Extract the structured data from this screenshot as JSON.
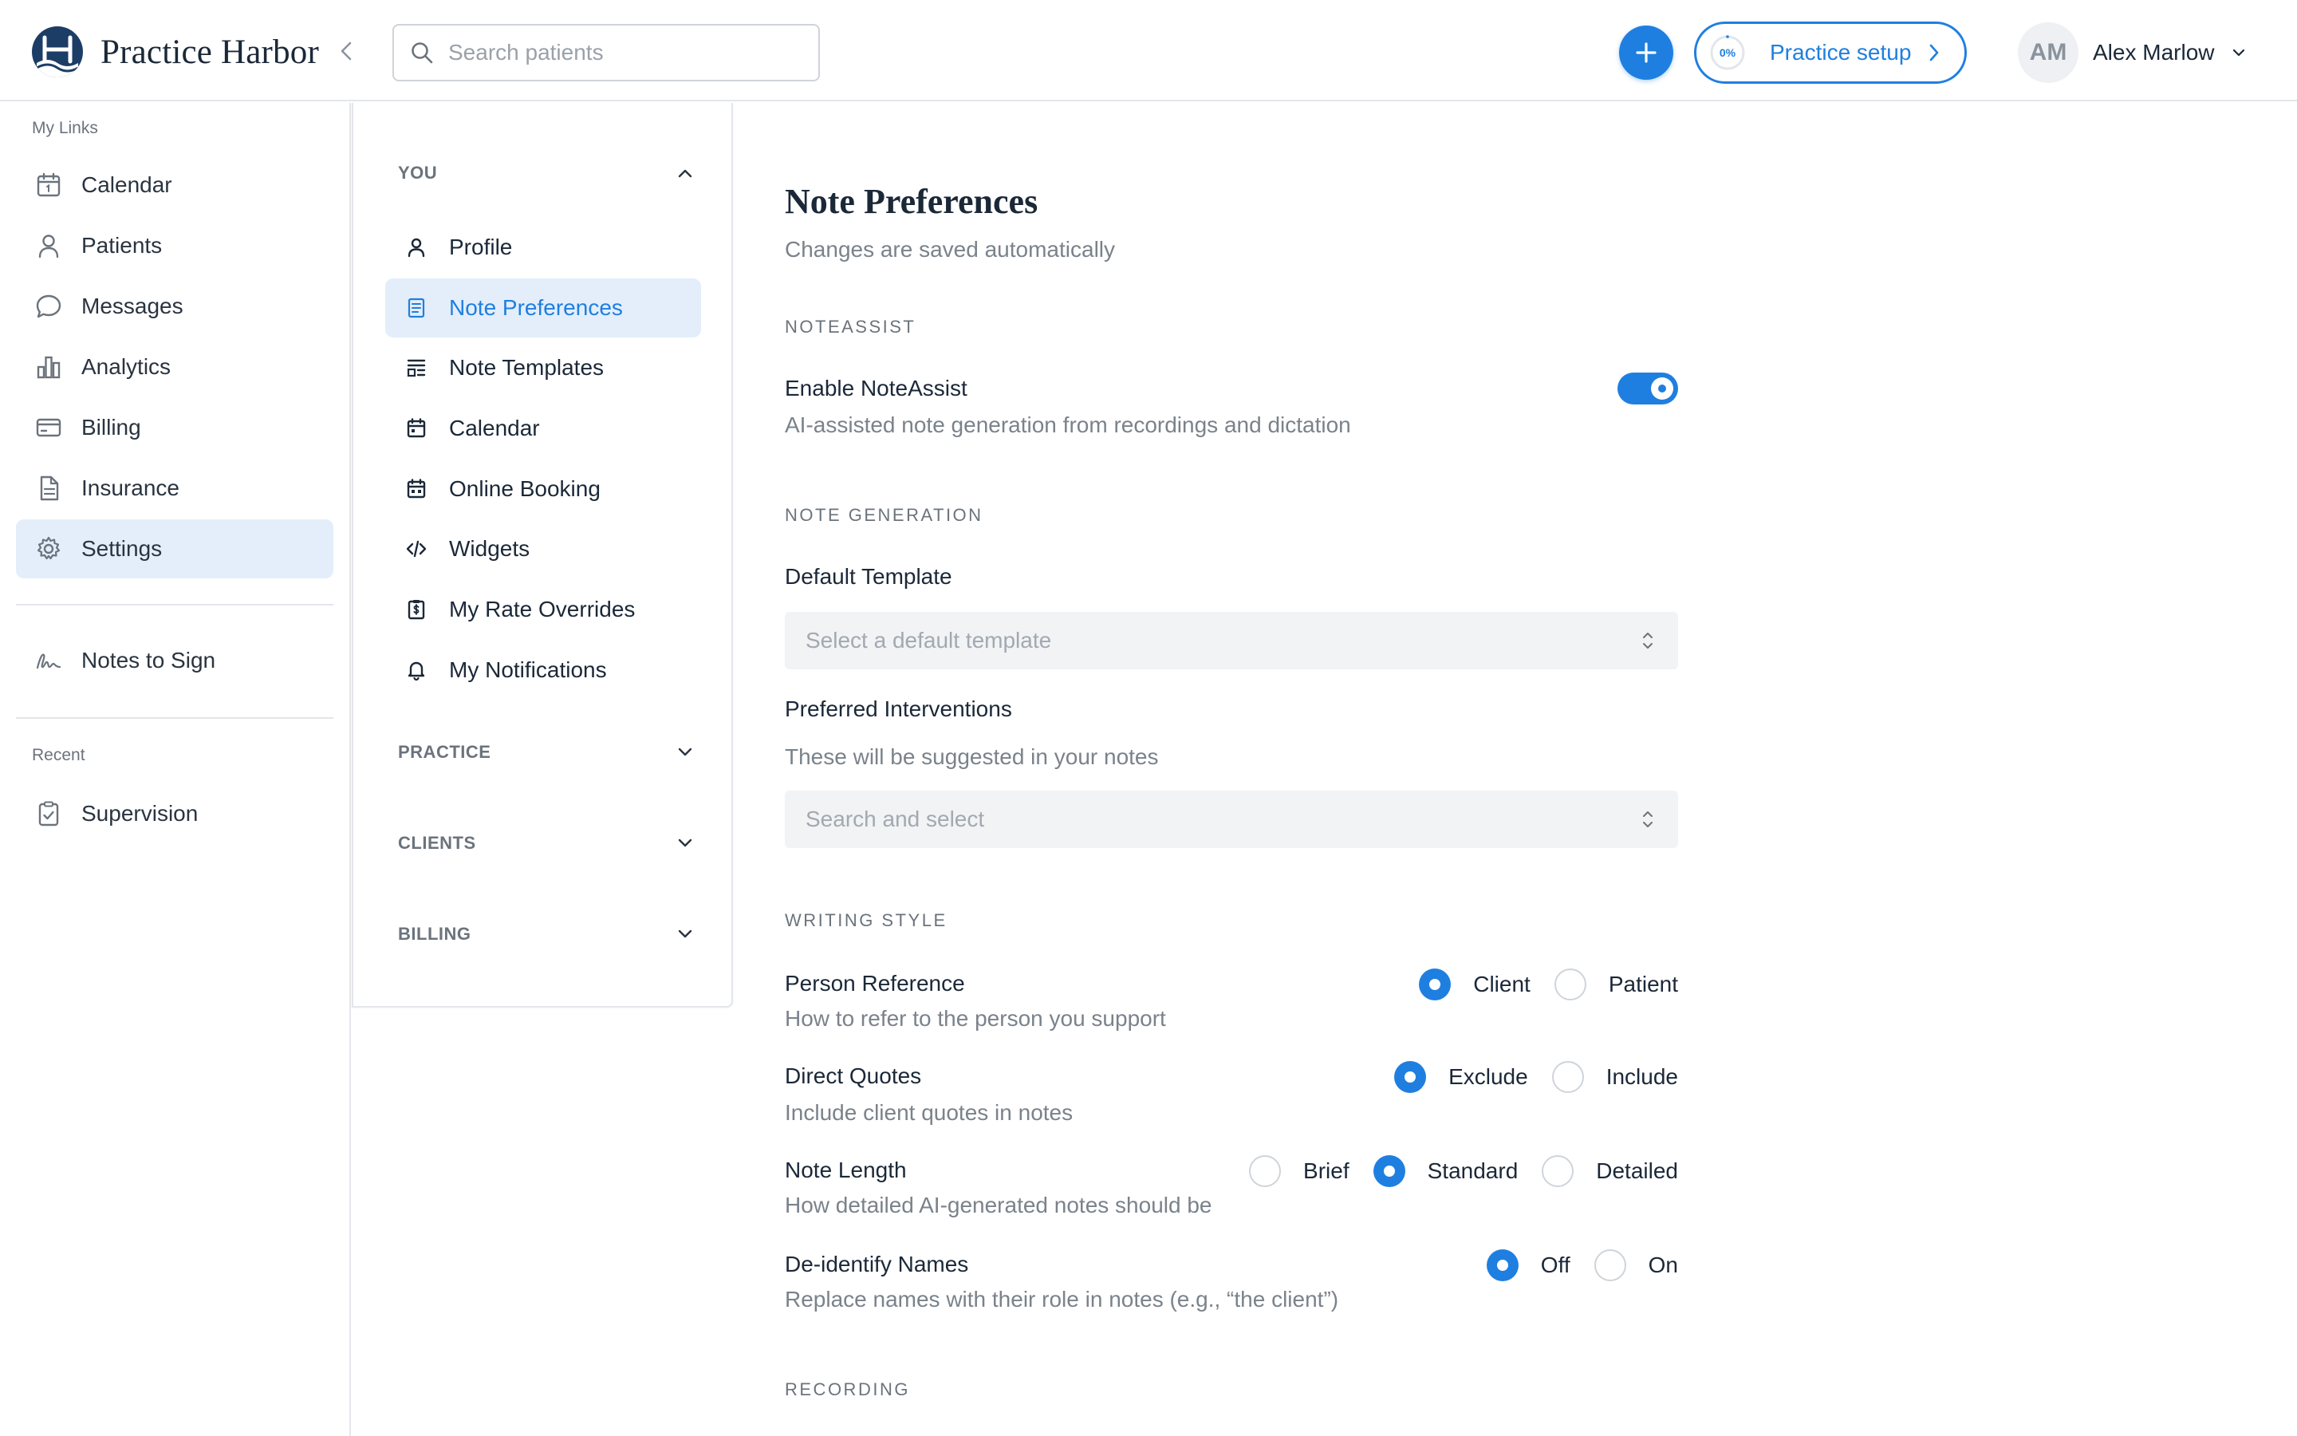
{
  "brand": {
    "name": "Practice Harbor"
  },
  "search": {
    "placeholder": "Search patients"
  },
  "setup": {
    "progress": "0%",
    "label": "Practice setup"
  },
  "user": {
    "initials": "AM",
    "name": "Alex Marlow"
  },
  "sidebar": {
    "my_links_label": "My Links",
    "items": [
      {
        "label": "Calendar"
      },
      {
        "label": "Patients"
      },
      {
        "label": "Messages"
      },
      {
        "label": "Analytics"
      },
      {
        "label": "Billing"
      },
      {
        "label": "Insurance"
      },
      {
        "label": "Settings",
        "active": true
      }
    ],
    "notes_to_sign": "Notes to Sign",
    "recent_label": "Recent",
    "recent_items": [
      {
        "label": "Supervision"
      }
    ]
  },
  "settings_nav": {
    "you_label": "YOU",
    "you_items": [
      {
        "label": "Profile"
      },
      {
        "label": "Note Preferences",
        "active": true
      },
      {
        "label": "Note Templates"
      },
      {
        "label": "Calendar"
      },
      {
        "label": "Online Booking"
      },
      {
        "label": "Widgets"
      },
      {
        "label": "My Rate Overrides"
      },
      {
        "label": "My Notifications"
      }
    ],
    "practice_label": "PRACTICE",
    "clients_label": "CLIENTS",
    "billing_label": "BILLING"
  },
  "main": {
    "title": "Note Preferences",
    "subtitle": "Changes are saved automatically",
    "noteassist": {
      "heading": "NOTEASSIST",
      "enable_label": "Enable NoteAssist",
      "enable_desc": "AI-assisted note generation from recordings and dictation",
      "enabled": true
    },
    "generation": {
      "heading": "NOTE GENERATION",
      "template_label": "Default Template",
      "template_placeholder": "Select a default template",
      "interventions_label": "Preferred Interventions",
      "interventions_desc": "These will be suggested in your notes",
      "interventions_placeholder": "Search and select"
    },
    "writing_style": {
      "heading": "WRITING STYLE",
      "person_reference": {
        "label": "Person Reference",
        "desc": "How to refer to the person you support",
        "options": [
          "Client",
          "Patient"
        ],
        "selected": "Client"
      },
      "direct_quotes": {
        "label": "Direct Quotes",
        "desc": "Include client quotes in notes",
        "options": [
          "Exclude",
          "Include"
        ],
        "selected": "Exclude"
      },
      "note_length": {
        "label": "Note Length",
        "desc": "How detailed AI-generated notes should be",
        "options": [
          "Brief",
          "Standard",
          "Detailed"
        ],
        "selected": "Standard"
      },
      "deidentify": {
        "label": "De-identify Names",
        "desc": "Replace names with their role in notes (e.g., “the client”)",
        "options": [
          "Off",
          "On"
        ],
        "selected": "Off"
      }
    },
    "recording": {
      "heading": "RECORDING"
    }
  },
  "colors": {
    "accent": "#1f7fe0",
    "active_bg": "#e3eefa",
    "brand_dark": "#1c3d66"
  }
}
